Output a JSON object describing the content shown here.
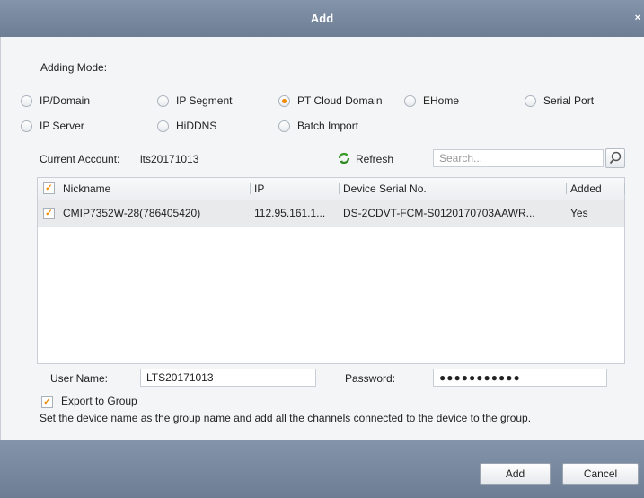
{
  "dialog": {
    "title": "Add",
    "close_glyph": "×"
  },
  "adding_mode": {
    "label": "Adding Mode:",
    "options": [
      {
        "label": "IP/Domain",
        "selected": false
      },
      {
        "label": "IP Segment",
        "selected": false
      },
      {
        "label": "PT Cloud Domain",
        "selected": true
      },
      {
        "label": "EHome",
        "selected": false
      },
      {
        "label": "Serial Port",
        "selected": false
      },
      {
        "label": "IP Server",
        "selected": false
      },
      {
        "label": "HiDDNS",
        "selected": false
      },
      {
        "label": "Batch Import",
        "selected": false
      }
    ]
  },
  "account": {
    "label": "Current Account:",
    "value": "lts20171013",
    "refresh_label": "Refresh",
    "search_placeholder": "Search..."
  },
  "table": {
    "columns": [
      "Nickname",
      "IP",
      "Device Serial No.",
      "Added"
    ],
    "rows": [
      {
        "checked": true,
        "nickname": "CMIP7352W-28(786405420)",
        "ip": "112.95.161.1...",
        "serial": "DS-2CDVT-FCM-S0120170703AAWR...",
        "added": "Yes"
      }
    ]
  },
  "credentials": {
    "user_label": "User Name:",
    "user_value": "LTS20171013",
    "password_label": "Password:",
    "password_value": "●●●●●●●●●●●"
  },
  "export": {
    "checked": true,
    "label": "Export to Group",
    "description": "Set the device name as the group name and add all the channels connected to the device to the group."
  },
  "buttons": {
    "add": "Add",
    "cancel": "Cancel"
  },
  "colors": {
    "accent": "#f08a00",
    "titlebar": "#7b8ba1",
    "refresh_icon": "#3a9a2a"
  }
}
